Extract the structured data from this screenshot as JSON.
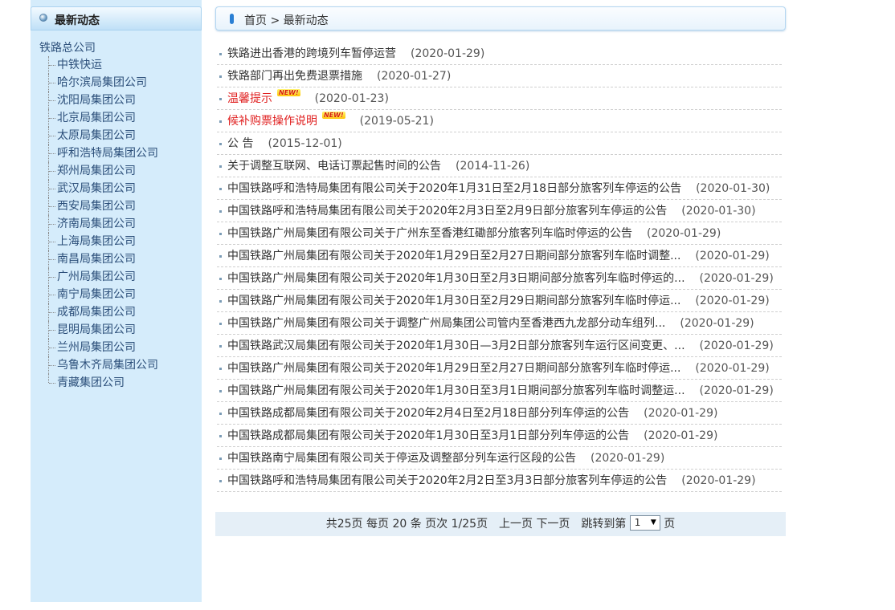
{
  "sidebar": {
    "title": "最新动态",
    "root": "铁路总公司",
    "items": [
      "中铁快运",
      "哈尔滨局集团公司",
      "沈阳局集团公司",
      "北京局集团公司",
      "太原局集团公司",
      "呼和浩特局集团公司",
      "郑州局集团公司",
      "武汉局集团公司",
      "西安局集团公司",
      "济南局集团公司",
      "上海局集团公司",
      "南昌局集团公司",
      "广州局集团公司",
      "南宁局集团公司",
      "成都局集团公司",
      "昆明局集团公司",
      "兰州局集团公司",
      "乌鲁木齐局集团公司",
      "青藏集团公司"
    ]
  },
  "breadcrumb": {
    "home": "首页",
    "separator": ">",
    "current": "最新动态"
  },
  "badge_text": "NEW!",
  "news": [
    {
      "title": "铁路进出香港的跨境列车暂停运营",
      "date": "(2020-01-29)",
      "red": false,
      "new": false
    },
    {
      "title": "铁路部门再出免费退票措施",
      "date": "(2020-01-27)",
      "red": false,
      "new": false
    },
    {
      "title": "温馨提示",
      "date": "(2020-01-23)",
      "red": true,
      "new": true
    },
    {
      "title": "候补购票操作说明",
      "date": "(2019-05-21)",
      "red": true,
      "new": true
    },
    {
      "title": "公 告",
      "date": "(2015-12-01)",
      "red": false,
      "new": false
    },
    {
      "title": "关于调整互联网、电话订票起售时间的公告",
      "date": "(2014-11-26)",
      "red": false,
      "new": false
    },
    {
      "title": "中国铁路呼和浩特局集团有限公司关于2020年1月31日至2月18日部分旅客列车停运的公告",
      "date": "(2020-01-30)",
      "red": false,
      "new": false
    },
    {
      "title": "中国铁路呼和浩特局集团有限公司关于2020年2月3日至2月9日部分旅客列车停运的公告",
      "date": "(2020-01-30)",
      "red": false,
      "new": false
    },
    {
      "title": "中国铁路广州局集团有限公司关于广州东至香港红磡部分旅客列车临时停运的公告",
      "date": "(2020-01-29)",
      "red": false,
      "new": false
    },
    {
      "title": "中国铁路广州局集团有限公司关于2020年1月29日至2月27日期间部分旅客列车临时调整...",
      "date": "(2020-01-29)",
      "red": false,
      "new": false
    },
    {
      "title": "中国铁路广州局集团有限公司关于2020年1月30日至2月3日期间部分旅客列车临时停运的...",
      "date": "(2020-01-29)",
      "red": false,
      "new": false
    },
    {
      "title": "中国铁路广州局集团有限公司关于2020年1月30日至2月29日期间部分旅客列车临时停运...",
      "date": "(2020-01-29)",
      "red": false,
      "new": false
    },
    {
      "title": "中国铁路广州局集团有限公司关于调整广州局集团公司管内至香港西九龙部分动车组列...",
      "date": "(2020-01-29)",
      "red": false,
      "new": false
    },
    {
      "title": "中国铁路武汉局集团有限公司关于2020年1月30日—3月2日部分旅客列车运行区间变更、...",
      "date": "(2020-01-29)",
      "red": false,
      "new": false
    },
    {
      "title": "中国铁路广州局集团有限公司关于2020年1月29日至2月27日期间部分旅客列车临时停运...",
      "date": "(2020-01-29)",
      "red": false,
      "new": false
    },
    {
      "title": "中国铁路广州局集团有限公司关于2020年1月30日至3月1日期间部分旅客列车临时调整运...",
      "date": "(2020-01-29)",
      "red": false,
      "new": false
    },
    {
      "title": "中国铁路成都局集团有限公司关于2020年2月4日至2月18日部分列车停运的公告",
      "date": "(2020-01-29)",
      "red": false,
      "new": false
    },
    {
      "title": "中国铁路成都局集团有限公司关于2020年1月30日至3月1日部分列车停运的公告",
      "date": "(2020-01-29)",
      "red": false,
      "new": false
    },
    {
      "title": "中国铁路南宁局集团有限公司关于停运及调整部分列车运行区段的公告",
      "date": "(2020-01-29)",
      "red": false,
      "new": false
    },
    {
      "title": "中国铁路呼和浩特局集团有限公司关于2020年2月2日至3月3日部分旅客列车停运的公告",
      "date": "(2020-01-29)",
      "red": false,
      "new": false
    }
  ],
  "pagination": {
    "total_pages": "共25页",
    "per_page": "每页 20 条",
    "current": "页次 1/25页",
    "prev": "上一页",
    "next": "下一页",
    "jump_label": "跳转到第",
    "jump_value": "1",
    "jump_suffix": "页"
  }
}
